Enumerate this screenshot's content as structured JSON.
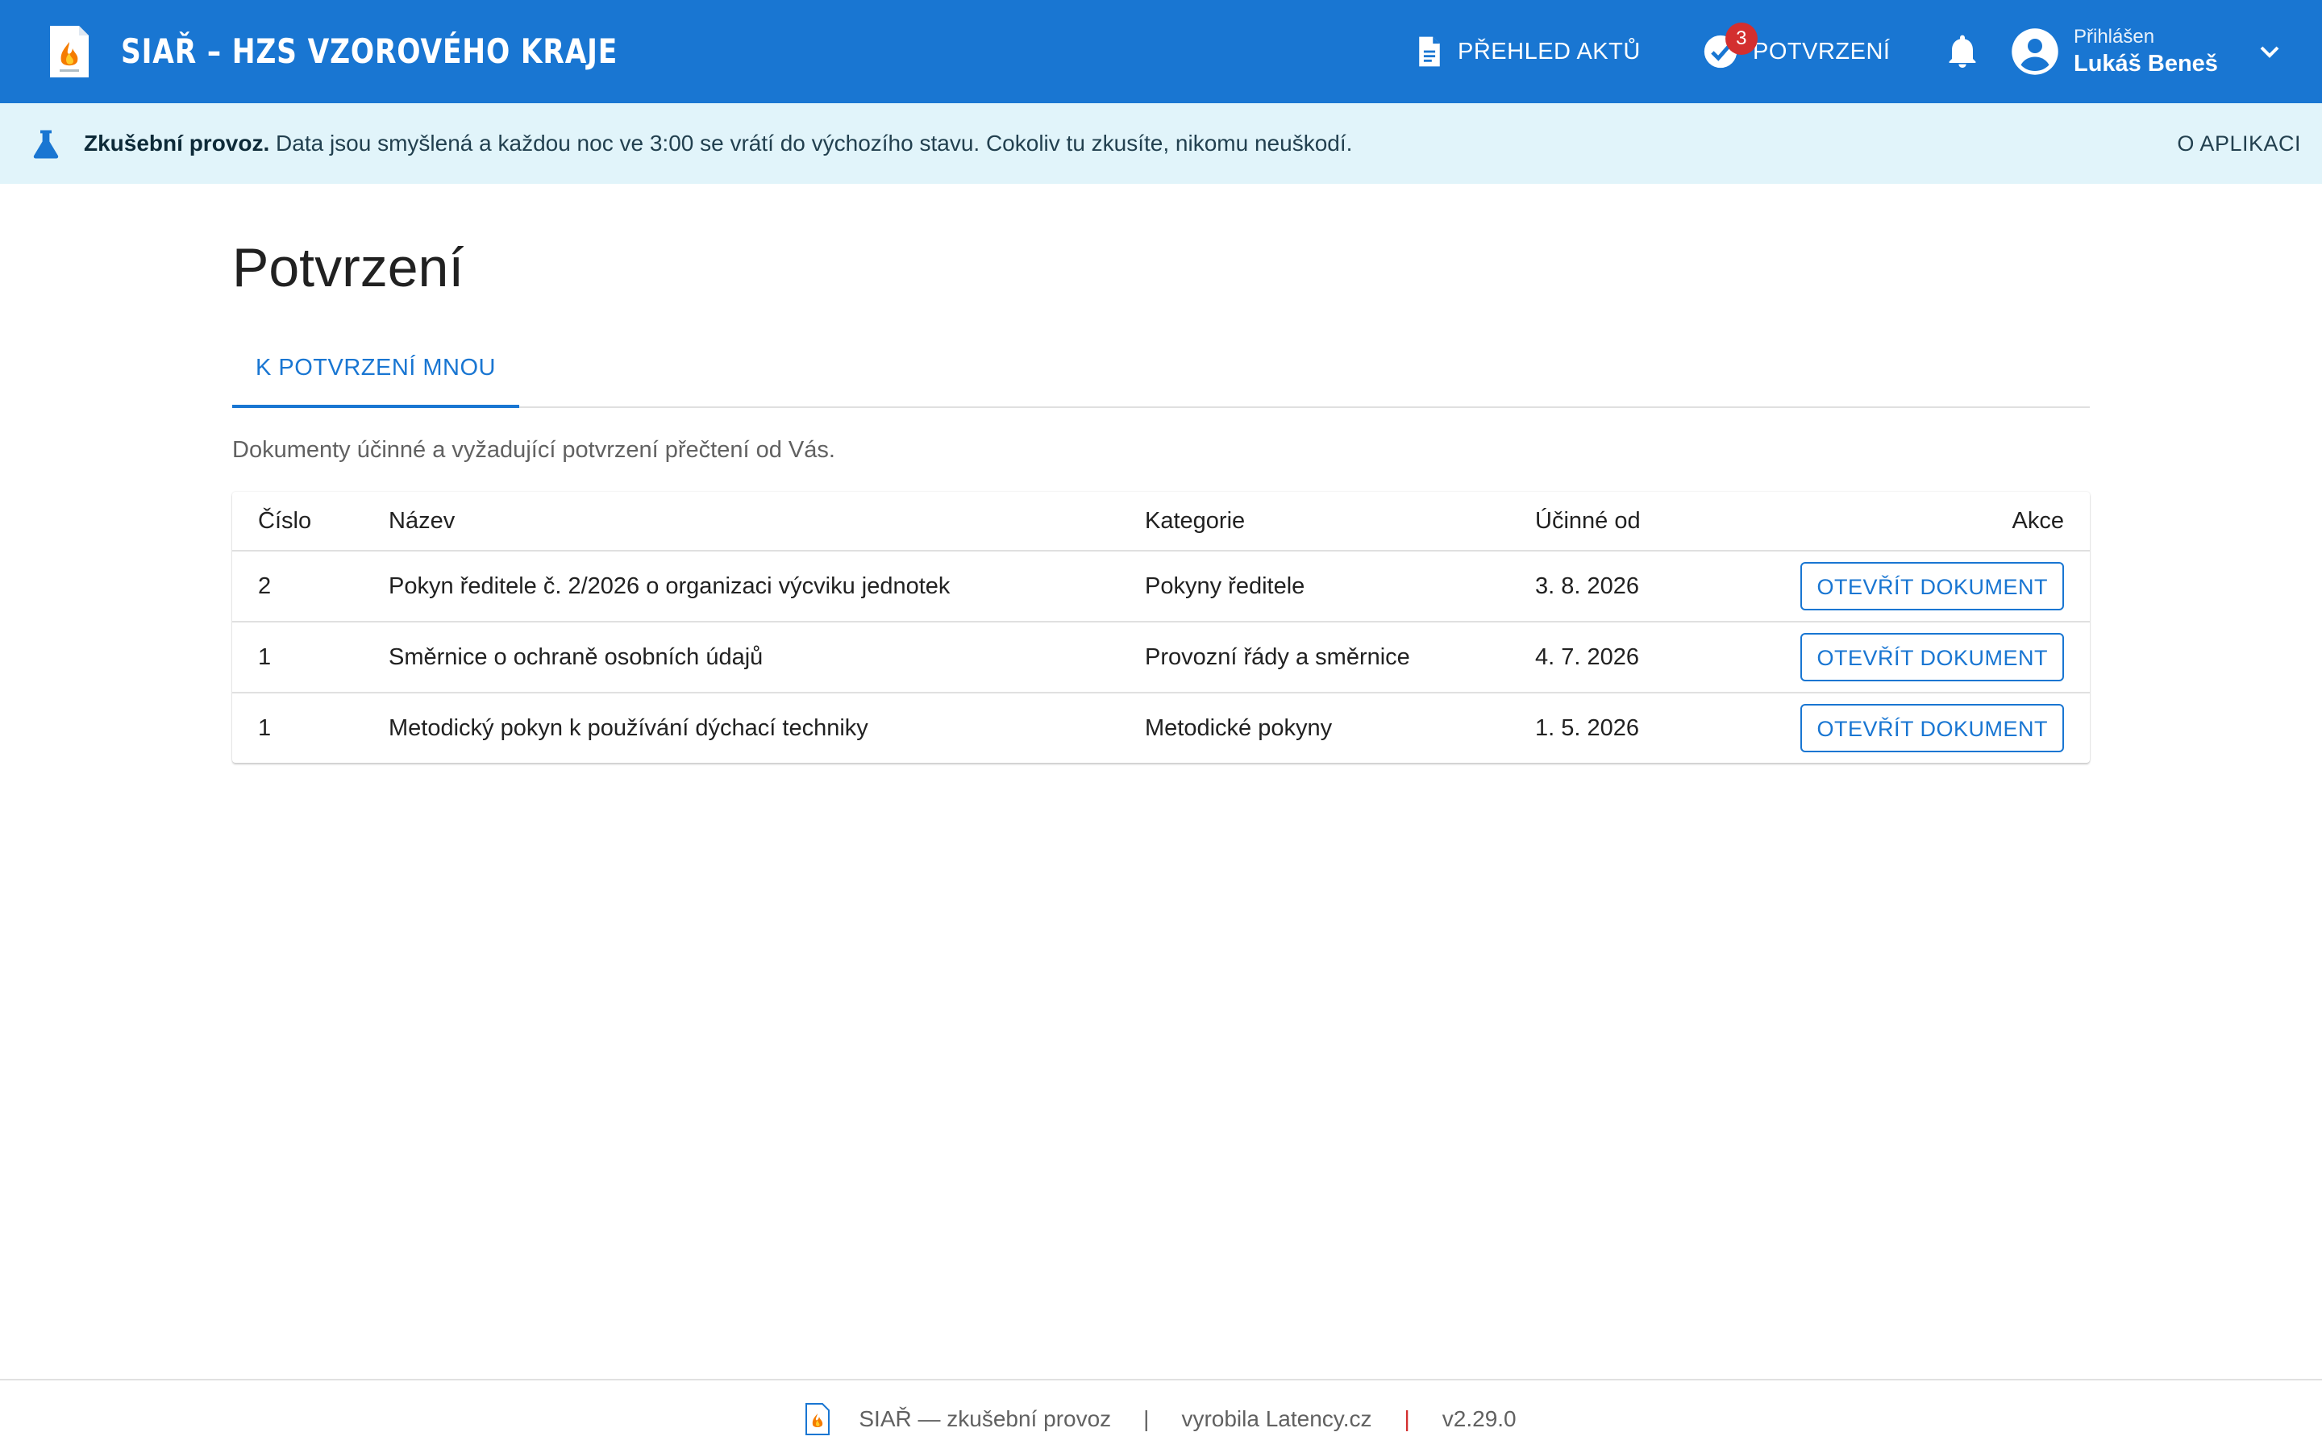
{
  "app": {
    "title": "SIAŘ – HZS VZOROVÉHO KRAJE",
    "logo_icon": "fire-document-icon"
  },
  "nav": {
    "acts_label": "PŘEHLED AKTŮ",
    "acts_icon": "document-icon",
    "confirm_label": "POTVRZENÍ",
    "confirm_icon": "check-circle-icon",
    "confirm_badge": "3",
    "bell_icon": "bell-icon"
  },
  "user": {
    "label": "Přihlášen",
    "name": "Lukáš Beneš",
    "icon": "account-circle-icon"
  },
  "banner": {
    "icon": "flask-icon",
    "strong": "Zkušební provoz.",
    "text": "Data jsou smyšlená a každou noc ve 3:00 se vrátí do výchozího stavu. Cokoliv tu zkusíte, nikomu neuškodí.",
    "about_label": "O APLIKACI"
  },
  "page": {
    "title": "Potvrzení",
    "tabs": [
      {
        "label": "K POTVRZENÍ MNOU",
        "active": true
      }
    ],
    "subtitle": "Dokumenty účinné a vyžadující potvrzení přečtení od Vás."
  },
  "table": {
    "headers": {
      "number": "Číslo",
      "name": "Název",
      "category": "Kategorie",
      "effective": "Účinné od",
      "action": "Akce"
    },
    "rows": [
      {
        "number": "2",
        "name": "Pokyn ředitele č. 2/2026 o organizaci výcviku jednotek",
        "category": "Pokyny ředitele",
        "effective": "3. 8. 2026",
        "action": "OTEVŘÍT DOKUMENT"
      },
      {
        "number": "1",
        "name": "Směrnice o ochraně osobních údajů",
        "category": "Provozní řády a směrnice",
        "effective": "4. 7. 2026",
        "action": "OTEVŘÍT DOKUMENT"
      },
      {
        "number": "1",
        "name": "Metodický pokyn k používání dýchací techniky",
        "category": "Metodické pokyny",
        "effective": "1. 5. 2026",
        "action": "OTEVŘÍT DOKUMENT"
      }
    ]
  },
  "footer": {
    "app": "SIAŘ — zkušební provoz",
    "sep": "|",
    "maker": "vyrobila Latency.cz",
    "version": "v2.29.0"
  },
  "colors": {
    "primary": "#1976d2",
    "banner_bg": "#e1f4fa",
    "badge": "#d32f2f"
  }
}
